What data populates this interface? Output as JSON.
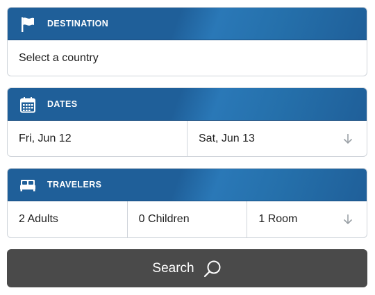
{
  "destination": {
    "header_label": "DESTINATION",
    "icon": "flag-icon",
    "value": "Select a country"
  },
  "dates": {
    "header_label": "DATES",
    "icon": "calendar-icon",
    "check_in": "Fri, Jun 12",
    "check_out": "Sat, Jun 13",
    "dropdown_icon": "arrow-down-icon"
  },
  "travelers": {
    "header_label": "TRAVELERS",
    "icon": "bed-icon",
    "adults": "2 Adults",
    "children": "0 Children",
    "rooms": "1 Room",
    "dropdown_icon": "arrow-down-icon"
  },
  "search": {
    "label": "Search",
    "icon": "search-icon"
  },
  "colors": {
    "header_blue": "#1f5f99",
    "header_blue_light": "#2a78b7",
    "button_gray": "#4a4a4a",
    "border": "#cfd4da",
    "text": "#1e1e1e"
  }
}
